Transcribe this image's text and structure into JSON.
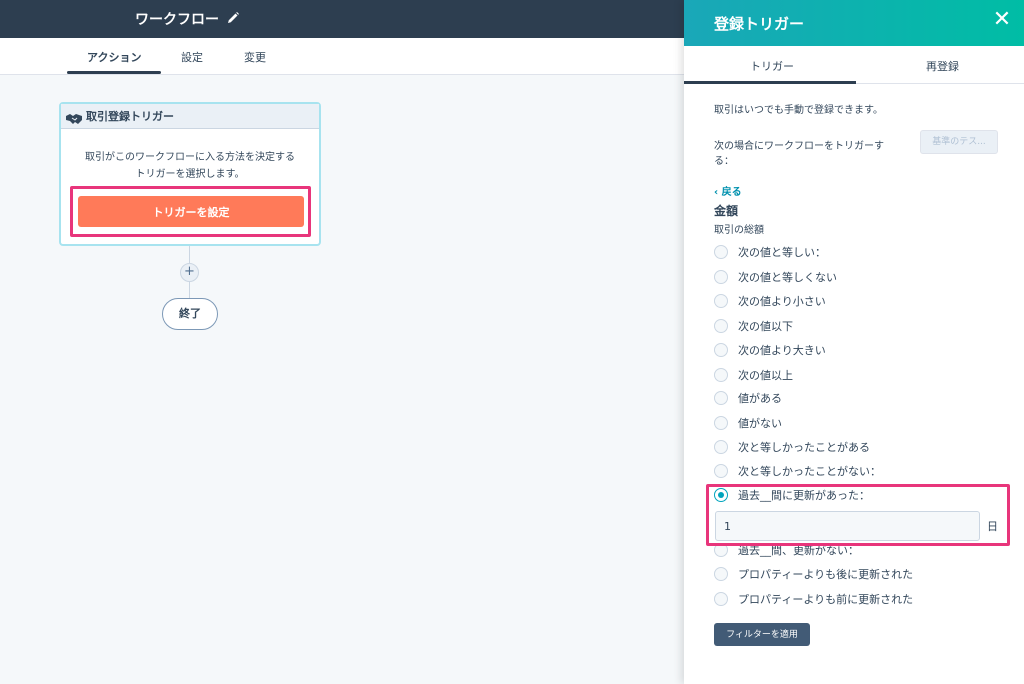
{
  "header": {
    "title": "ワークフロー",
    "edit_icon": "pencil-icon"
  },
  "tabs": [
    {
      "label": "アクション",
      "active": true
    },
    {
      "label": "設定",
      "active": false
    },
    {
      "label": "変更",
      "active": false
    }
  ],
  "canvas": {
    "trigger_card": {
      "title": "取引登録トリガー",
      "icon": "handshake-icon",
      "description_line1": "取引がこのワークフローに入る方法を決定する",
      "description_line2": "トリガーを選択します。",
      "button_label": "トリガーを設定"
    },
    "add_label": "+",
    "end_label": "終了"
  },
  "panel": {
    "title": "登録トリガー",
    "close_icon": "close-icon",
    "tabs": [
      {
        "label": "トリガー",
        "active": true
      },
      {
        "label": "再登録",
        "active": false
      }
    ],
    "info": "取引はいつでも手動で登録できます。",
    "condition_line1": "次の場合にワークフローをトリガーす",
    "condition_line2": "る：",
    "test_button": "基準のテス...",
    "back_label": "‹ 戻る",
    "property_name": "金額",
    "property_desc": "取引の総額",
    "options": [
      {
        "label": "次の値と等しい：",
        "checked": false
      },
      {
        "label": "次の値と等しくない",
        "checked": false
      },
      {
        "label": "次の値より小さい",
        "checked": false
      },
      {
        "label": "次の値以下",
        "checked": false
      },
      {
        "label": "次の値より大きい",
        "checked": false
      },
      {
        "label": "次の値以上",
        "checked": false
      },
      {
        "label": "値がある",
        "checked": false
      },
      {
        "label": "値がない",
        "checked": false
      },
      {
        "label": "次と等しかったことがある",
        "checked": false
      },
      {
        "label": "次と等しかったことがない：",
        "checked": false
      },
      {
        "label": "過去__間に更新があった：",
        "checked": true
      },
      {
        "label": "過去__間、更新がない：",
        "checked": false
      },
      {
        "label": "プロパティーよりも後に更新された",
        "checked": false
      },
      {
        "label": "プロパティーよりも前に更新された",
        "checked": false
      }
    ],
    "days_value": "1",
    "days_unit": "日",
    "apply_button": "フィルターを適用"
  },
  "colors": {
    "header_bg": "#2d3e50",
    "accent_orange": "#ff7a59",
    "panel_gradient_start": "#1aa7b8",
    "panel_gradient_end": "#00bda5",
    "highlight_pink": "#e8357b",
    "radio_teal": "#00a4bd",
    "apply_button_bg": "#425b76"
  }
}
